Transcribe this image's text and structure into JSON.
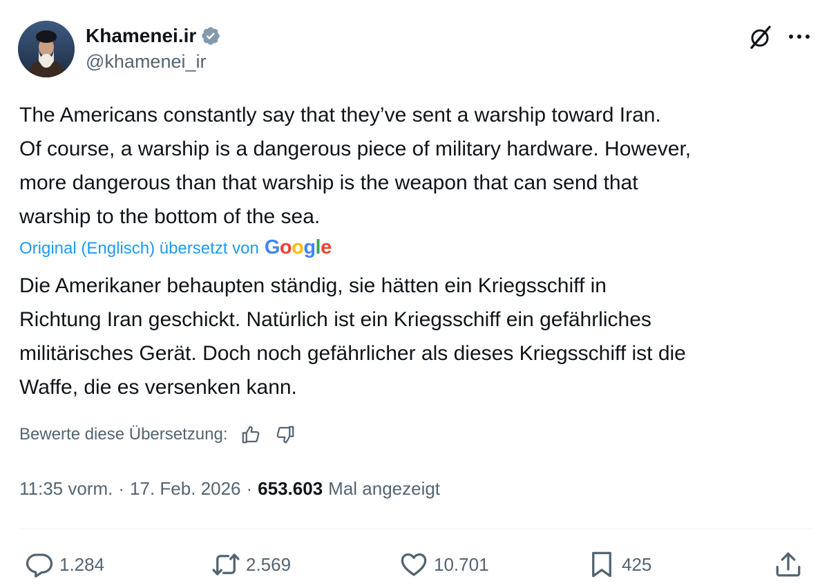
{
  "author": {
    "display_name": "Khamenei.ir",
    "handle": "@khamenei_ir",
    "verified": true,
    "verified_color": "#829aab"
  },
  "tweet": {
    "text": "The Americans constantly say that they’ve sent a warship toward Iran.\nOf course, a warship is a dangerous piece of military hardware. However,\nmore dangerous than that warship is the weapon that can send that\nwarship to the bottom of the sea.",
    "translated_by_label": "Original (Englisch) übersetzt von",
    "translation_provider": "Google",
    "translated_text": "Die Amerikaner behaupten ständig, sie hätten ein Kriegsschiff in\nRichtung Iran geschickt. Natürlich ist ein Kriegsschiff ein gefährliches\nmilitärisches Gerät. Doch noch gefährlicher als dieses Kriegsschiff ist die\nWaffe, die es versenken kann.",
    "rate_label": "Bewerte diese Übersetzung:",
    "time": "11:35 vorm.",
    "separator": "·",
    "date": "17. Feb. 2026",
    "views_count": "653.603",
    "views_label": "Mal angezeigt"
  },
  "actions": {
    "replies": "1.284",
    "reposts": "2.569",
    "likes": "10.701",
    "bookmarks": "425"
  },
  "icons": {
    "header": [
      "grok-icon",
      "more-icon"
    ],
    "rate": [
      "thumbs-up-icon",
      "thumbs-down-icon"
    ],
    "actions": [
      "reply-icon",
      "repost-icon",
      "like-icon",
      "bookmark-icon",
      "share-icon"
    ]
  },
  "colors": {
    "text_primary": "#0f1419",
    "text_secondary": "#536471",
    "link": "#1d9bf0",
    "divider": "#eff3f4"
  }
}
